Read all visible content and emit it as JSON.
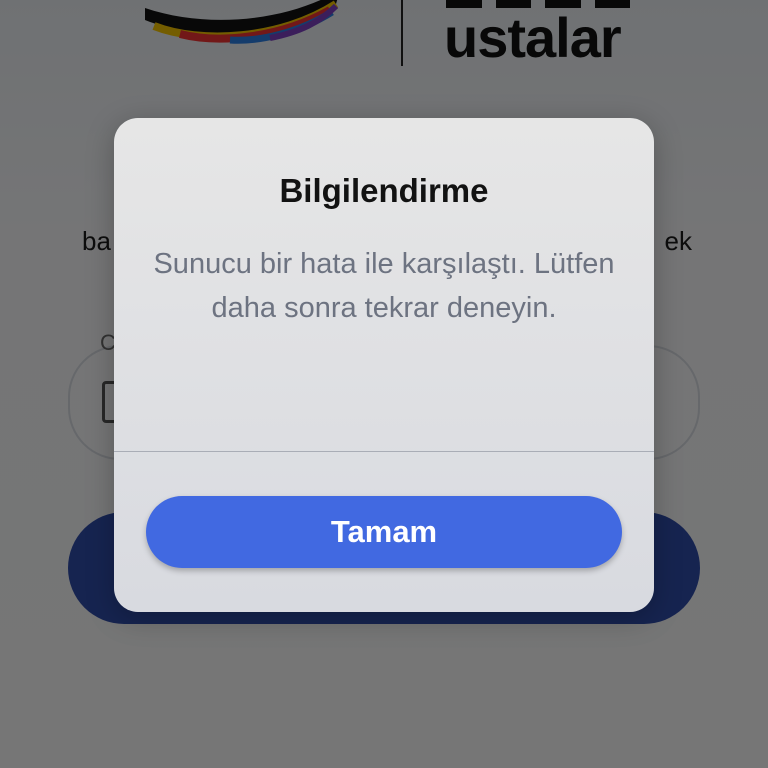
{
  "app": {
    "brand_text": "ustalar",
    "welcome_left": "ba",
    "welcome_right": "ek",
    "phone_label": "C"
  },
  "dialog": {
    "title": "Bilgilendirme",
    "message": "Sunucu bir hata ile karşılaştı. Lütfen daha sonra tekrar deneyin.",
    "button_label": "Tamam"
  },
  "colors": {
    "primary_button": "#4169e1",
    "background_button": "#2f4ba8",
    "title_text": "#121212",
    "message_text": "#6d7381"
  },
  "icons": {
    "brand_logo": "brand-swoosh-icon",
    "phone_field": "phone-icon"
  }
}
